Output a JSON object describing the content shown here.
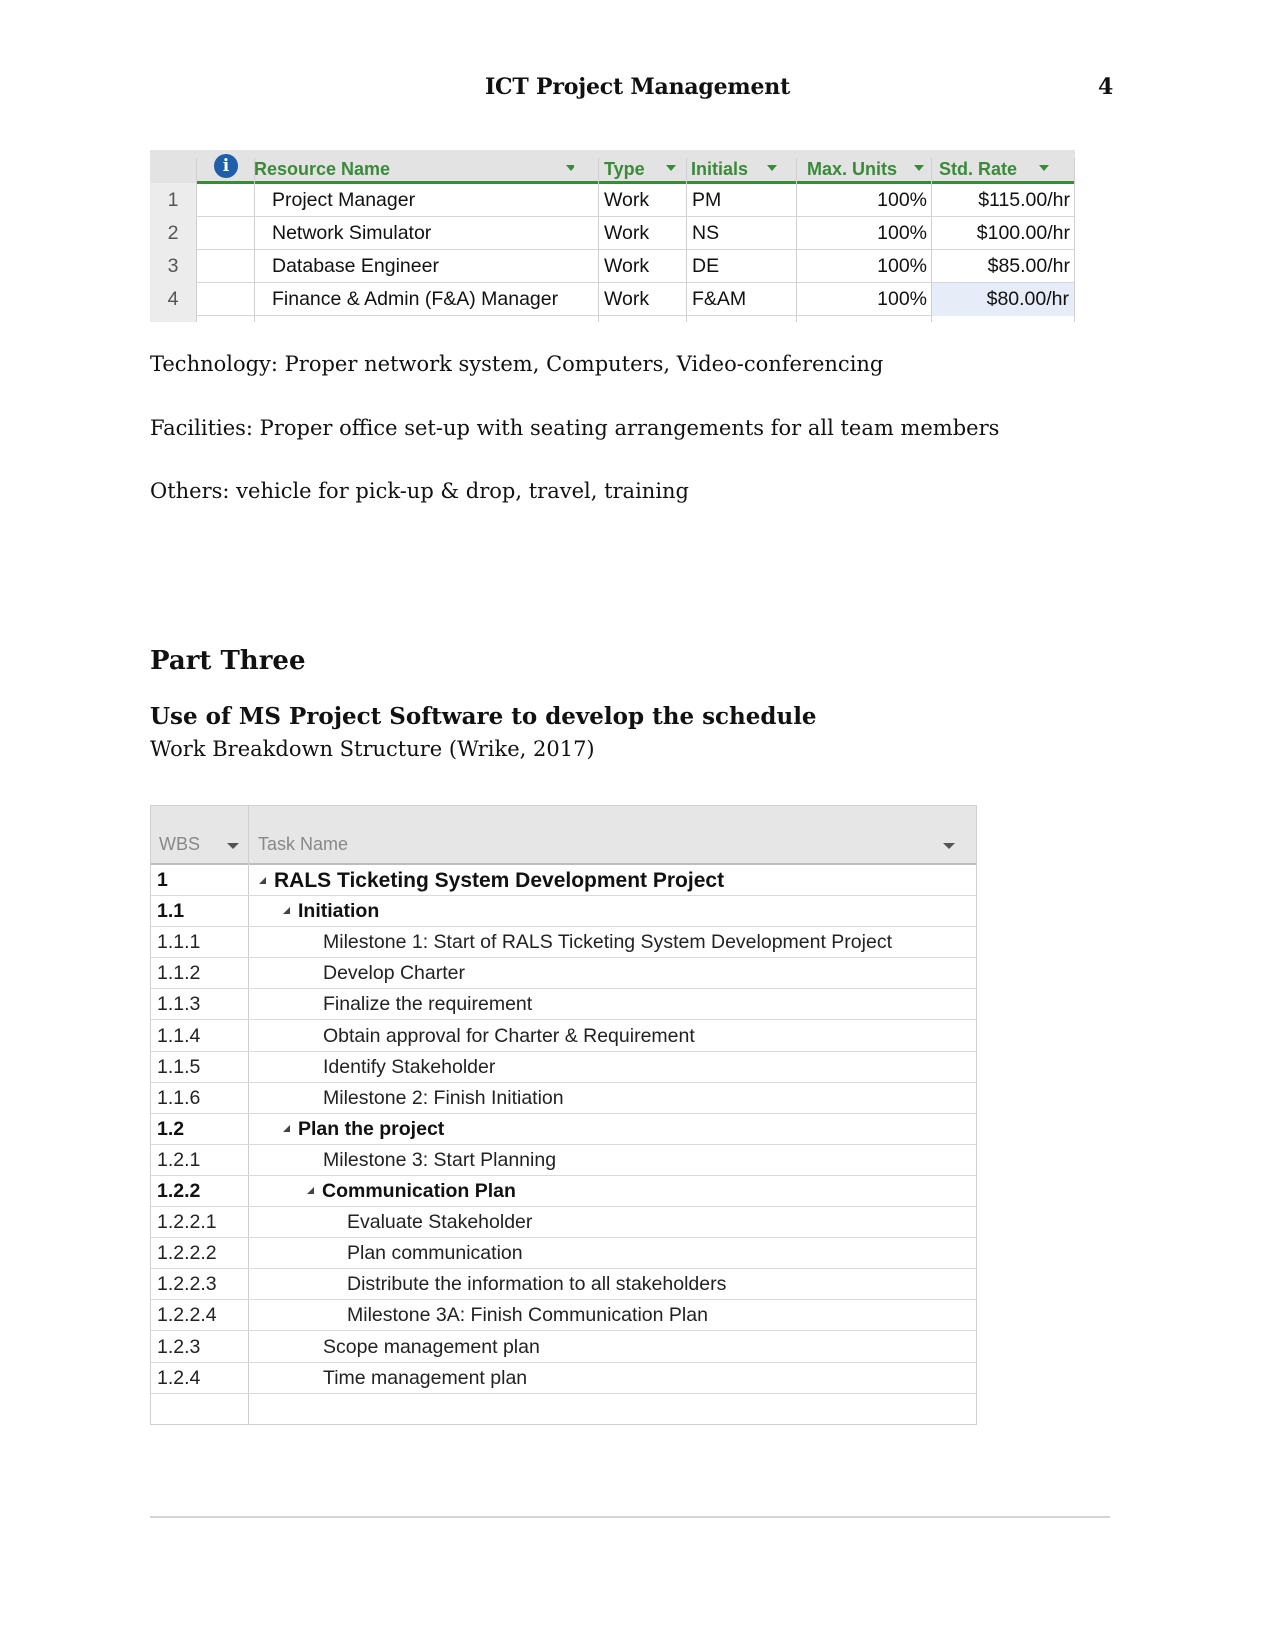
{
  "header": {
    "running_title": "ICT Project Management",
    "page_number": "4"
  },
  "resource_sheet": {
    "columns": [
      {
        "key": "info",
        "icon": "info-icon"
      },
      {
        "key": "name",
        "label": "Resource Name"
      },
      {
        "key": "type",
        "label": "Type"
      },
      {
        "key": "initials",
        "label": "Initials"
      },
      {
        "key": "max_units",
        "label": "Max. Units"
      },
      {
        "key": "std_rate",
        "label": "Std. Rate"
      }
    ],
    "rows": [
      {
        "id": "1",
        "name": "Project Manager",
        "type": "Work",
        "initials": "PM",
        "max_units": "100%",
        "std_rate": "$115.00/hr"
      },
      {
        "id": "2",
        "name": "Network Simulator",
        "type": "Work",
        "initials": "NS",
        "max_units": "100%",
        "std_rate": "$100.00/hr"
      },
      {
        "id": "3",
        "name": "Database Engineer",
        "type": "Work",
        "initials": "DE",
        "max_units": "100%",
        "std_rate": "$85.00/hr"
      },
      {
        "id": "4",
        "name": "Finance & Admin (F&A) Manager",
        "type": "Work",
        "initials": "F&AM",
        "max_units": "100%",
        "std_rate": "$80.00/hr"
      }
    ],
    "accent_color": "#3a8a3a"
  },
  "paragraphs": {
    "technology": "Technology: Proper network system, Computers, Video-conferencing",
    "facilities": "Facilities: Proper office set-up with seating arrangements for all team members",
    "others": "Others: vehicle for pick-up & drop, travel, training"
  },
  "part_three": {
    "heading": "Part Three",
    "subheading": "Use of MS Project Software to develop the schedule",
    "caption": "Work Breakdown Structure (Wrike, 2017)"
  },
  "wbs_table": {
    "columns": {
      "wbs": "WBS",
      "task_name": "Task Name"
    },
    "rows": [
      {
        "wbs": "1",
        "name": "RALS Ticketing System Development Project",
        "level": 0,
        "summary": true
      },
      {
        "wbs": "1.1",
        "name": "Initiation",
        "level": 1,
        "summary": true
      },
      {
        "wbs": "1.1.1",
        "name": "Milestone 1: Start of RALS Ticketing System Development Project",
        "level": 2,
        "summary": false
      },
      {
        "wbs": "1.1.2",
        "name": "Develop Charter",
        "level": 2,
        "summary": false
      },
      {
        "wbs": "1.1.3",
        "name": "Finalize the requirement",
        "level": 2,
        "summary": false
      },
      {
        "wbs": "1.1.4",
        "name": "Obtain approval for Charter & Requirement",
        "level": 2,
        "summary": false
      },
      {
        "wbs": "1.1.5",
        "name": "Identify Stakeholder",
        "level": 2,
        "summary": false
      },
      {
        "wbs": "1.1.6",
        "name": "Milestone 2: Finish Initiation",
        "level": 2,
        "summary": false
      },
      {
        "wbs": "1.2",
        "name": "Plan the project",
        "level": 1,
        "summary": true
      },
      {
        "wbs": "1.2.1",
        "name": "Milestone 3: Start Planning",
        "level": 2,
        "summary": false
      },
      {
        "wbs": "1.2.2",
        "name": "Communication Plan",
        "level": 2,
        "summary": true
      },
      {
        "wbs": "1.2.2.1",
        "name": "Evaluate Stakeholder",
        "level": 3,
        "summary": false
      },
      {
        "wbs": "1.2.2.2",
        "name": "Plan communication",
        "level": 3,
        "summary": false
      },
      {
        "wbs": "1.2.2.3",
        "name": "Distribute the information to all stakeholders",
        "level": 3,
        "summary": false
      },
      {
        "wbs": "1.2.2.4",
        "name": "Milestone 3A: Finish Communication Plan",
        "level": 3,
        "summary": false
      },
      {
        "wbs": "1.2.3",
        "name": "Scope management plan",
        "level": 2,
        "summary": false
      },
      {
        "wbs": "1.2.4",
        "name": "Time management plan",
        "level": 2,
        "summary": false
      }
    ]
  }
}
